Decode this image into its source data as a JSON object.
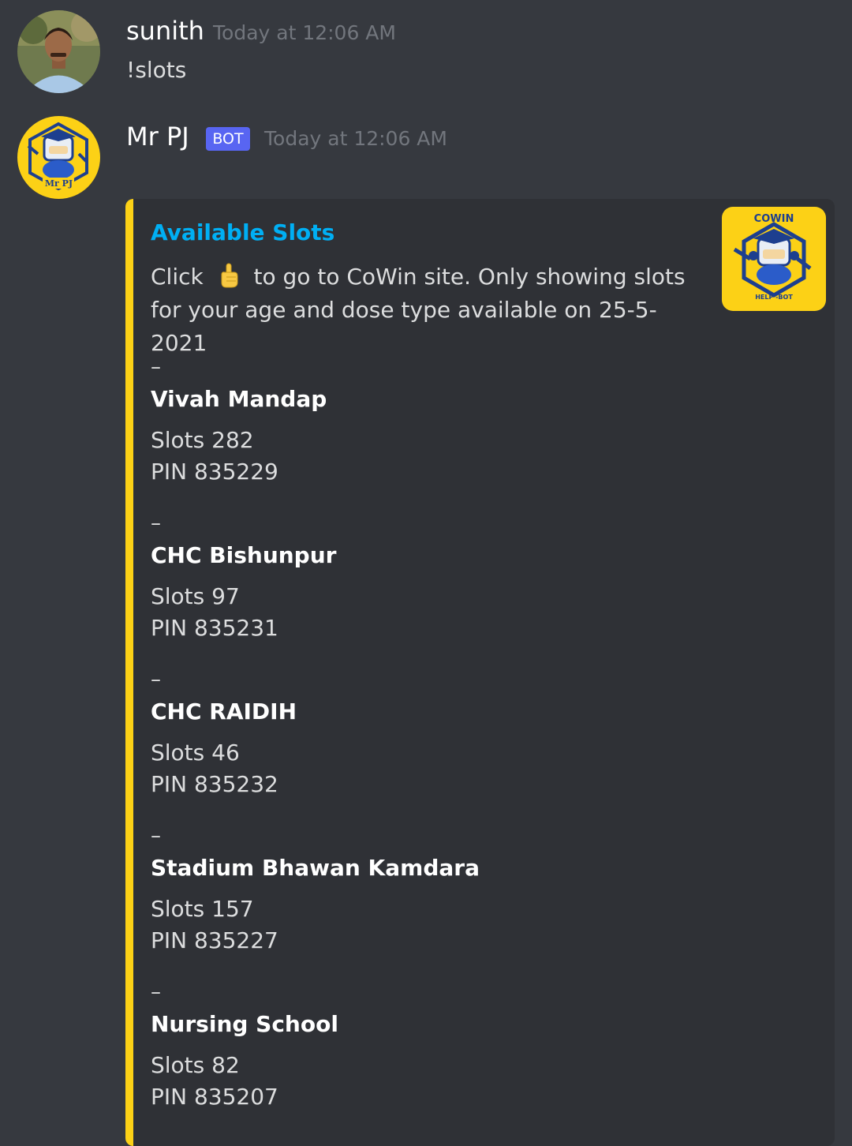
{
  "messages": {
    "user": {
      "username": "sunith",
      "timestamp": "Today at 12:06 AM",
      "text": "!slots"
    },
    "bot": {
      "username": "Mr PJ",
      "tag": "BOT",
      "timestamp": "Today at 12:06 AM",
      "avatar_text": "Mr PJ"
    }
  },
  "embed": {
    "accent_color": "#fcd116",
    "title": "Available Slots",
    "desc_before": "Click",
    "desc_icon": "pointing-up-hand-icon",
    "desc_after": "to go to CoWin site. Only showing slots for your age and dose type available on 25-5-2021",
    "thumbnail": {
      "top_text": "COWIN",
      "bottom_text": "HELP -BOT"
    },
    "fields": [
      {
        "dash": "–",
        "name": "Vivah Mandap",
        "slots": "Slots 282",
        "pin": "PIN 835229"
      },
      {
        "dash": "–",
        "name": "CHC Bishunpur",
        "slots": "Slots 97",
        "pin": "PIN 835231"
      },
      {
        "dash": "–",
        "name": "CHC RAIDIH",
        "slots": "Slots 46",
        "pin": "PIN 835232"
      },
      {
        "dash": "–",
        "name": "Stadium Bhawan Kamdara",
        "slots": "Slots 157",
        "pin": "PIN 835227"
      },
      {
        "dash": "–",
        "name": "Nursing School",
        "slots": "Slots 82",
        "pin": "PIN 835207"
      }
    ]
  },
  "colors": {
    "background": "#36393f",
    "embed_background": "#2f3136",
    "link_blue": "#00aff4",
    "bot_tag": "#5865f2"
  }
}
